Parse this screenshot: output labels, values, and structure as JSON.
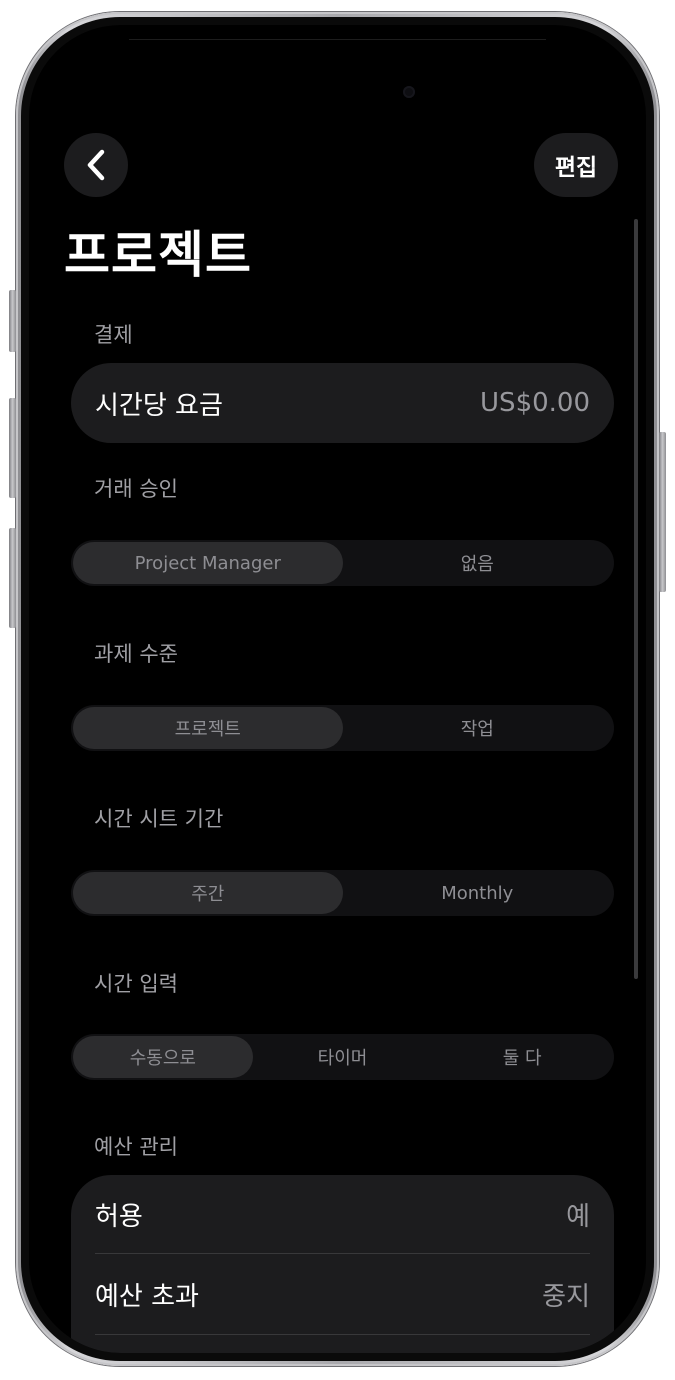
{
  "header": {
    "back_icon": "chevron-left-icon",
    "edit_label": "편집",
    "title": "프로젝트"
  },
  "billing": {
    "section_label": "결제",
    "hourly_rate_label": "시간당 요금",
    "hourly_rate_value": "US$0.00"
  },
  "transaction_approval": {
    "section_label": "거래 승인",
    "options": [
      "Project Manager",
      "없음"
    ],
    "selected": "Project Manager"
  },
  "task_level": {
    "section_label": "과제 수준",
    "options": [
      "프로젝트",
      "작업"
    ],
    "selected": "프로젝트"
  },
  "timesheet_period": {
    "section_label": "시간 시트 기간",
    "options": [
      "주간",
      "Monthly"
    ],
    "selected": "주간"
  },
  "time_entry": {
    "section_label": "시간 입력",
    "options": [
      "수동으로",
      "타이머",
      "둘 다"
    ],
    "selected": "수동으로"
  },
  "budget": {
    "section_label": "예산 관리",
    "rows": [
      {
        "label": "허용",
        "value": "예"
      },
      {
        "label": "예산 초과",
        "value": "중지"
      }
    ]
  },
  "colors": {
    "background": "#000000",
    "card": "#1c1c1e",
    "segment_selected": "#2c2c2e",
    "secondary_text": "#98989d"
  }
}
